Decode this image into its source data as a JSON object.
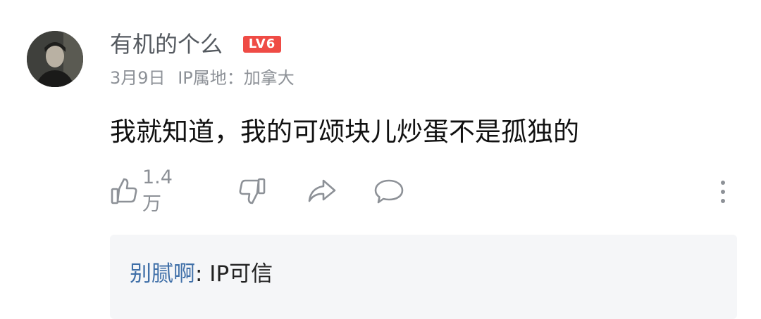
{
  "comment": {
    "username": "有机的个么",
    "level_badge": "LV6",
    "date": "3月9日",
    "ip_location": "IP属地：加拿大",
    "text": "我就知道，我的可颂块儿炒蛋不是孤独的",
    "like_count": "1.4万"
  },
  "actions": {
    "icons": [
      "thumbs-up-icon",
      "thumbs-down-icon",
      "share-icon",
      "comment-icon",
      "more-vertical-icon"
    ]
  },
  "reply": {
    "author": "别腻啊",
    "separator": ":",
    "text": " IP可信"
  },
  "colors": {
    "badge": "#ef4b45",
    "reply_author": "#3f6fa8",
    "muted": "#8d9197",
    "reply_bg": "#f5f6f8"
  }
}
